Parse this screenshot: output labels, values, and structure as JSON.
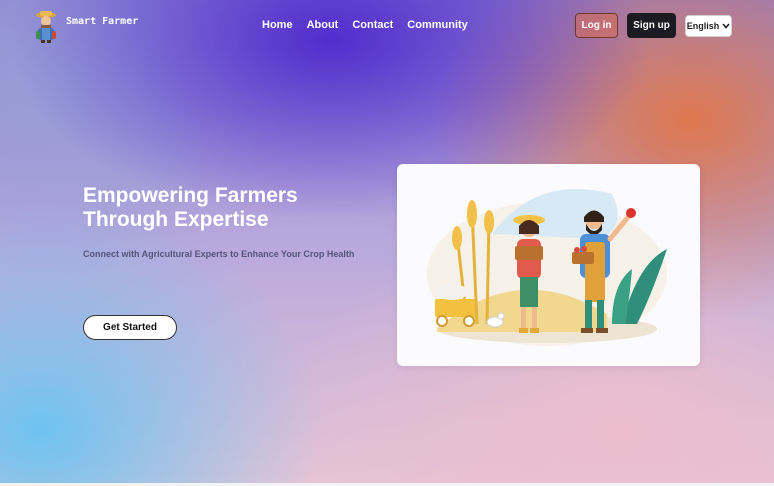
{
  "header": {
    "brand": "Smart Farmer",
    "nav": [
      "Home",
      "About",
      "Contact",
      "Community"
    ],
    "login_label": "Log in",
    "signup_label": "Sign up",
    "language": "English"
  },
  "hero": {
    "title_line1": "Empowering Farmers",
    "title_line2": "Through Expertise",
    "subtitle": "Connect with Agricultural Experts to Enhance Your Crop Health",
    "cta_label": "Get Started"
  },
  "colors": {
    "accent_purple": "#4e28cd",
    "accent_orange": "#e27646",
    "signup_bg": "#1c1b22"
  },
  "icons": {
    "logo": "farmer-logo-icon",
    "language_toggle": "chevron-down-icon"
  }
}
